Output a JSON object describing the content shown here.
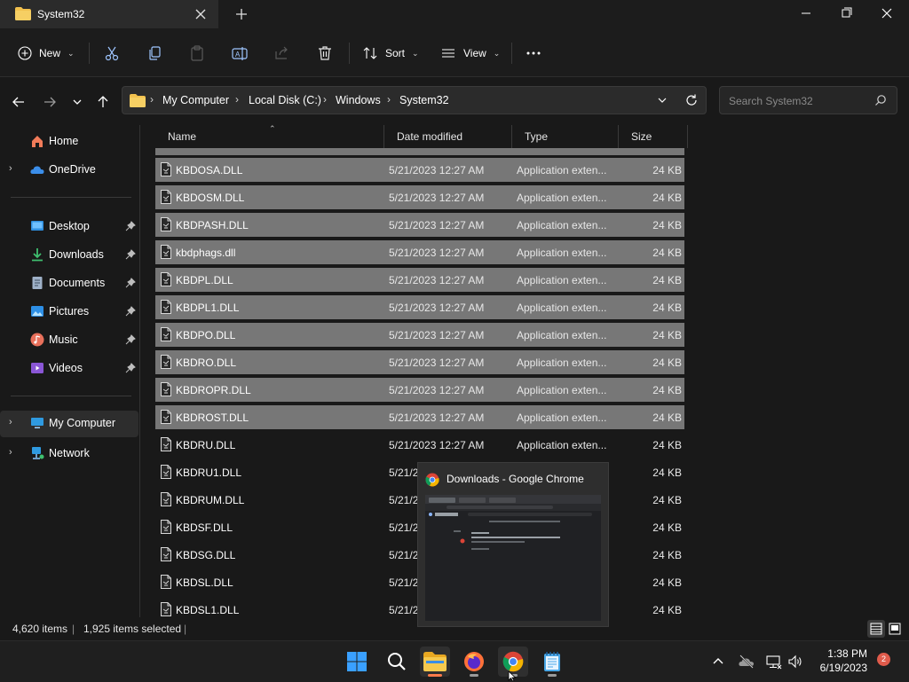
{
  "window": {
    "tab_title": "System32"
  },
  "toolbar": {
    "new_label": "New",
    "sort_label": "Sort",
    "view_label": "View"
  },
  "address": {
    "crumbs": [
      "My Computer",
      "Local Disk (C:)",
      "Windows",
      "System32"
    ]
  },
  "search": {
    "placeholder": "Search System32"
  },
  "sidebar": {
    "items": [
      {
        "label": "Home",
        "icon": "home-icon"
      },
      {
        "label": "OneDrive",
        "icon": "cloud-icon"
      },
      {
        "label": "Desktop",
        "icon": "desktop-icon"
      },
      {
        "label": "Downloads",
        "icon": "download-icon"
      },
      {
        "label": "Documents",
        "icon": "document-icon"
      },
      {
        "label": "Pictures",
        "icon": "picture-icon"
      },
      {
        "label": "Music",
        "icon": "music-icon"
      },
      {
        "label": "Videos",
        "icon": "video-icon"
      },
      {
        "label": "My Computer",
        "icon": "computer-icon"
      },
      {
        "label": "Network",
        "icon": "network-icon"
      }
    ]
  },
  "columns": {
    "name": "Name",
    "date": "Date modified",
    "type": "Type",
    "size": "Size"
  },
  "files": [
    {
      "name": "KBDOSA.DLL",
      "date": "5/21/2023 12:27 AM",
      "type": "Application exten...",
      "size": "24 KB"
    },
    {
      "name": "KBDOSM.DLL",
      "date": "5/21/2023 12:27 AM",
      "type": "Application exten...",
      "size": "24 KB"
    },
    {
      "name": "KBDPASH.DLL",
      "date": "5/21/2023 12:27 AM",
      "type": "Application exten...",
      "size": "24 KB"
    },
    {
      "name": "kbdphags.dll",
      "date": "5/21/2023 12:27 AM",
      "type": "Application exten...",
      "size": "24 KB"
    },
    {
      "name": "KBDPL.DLL",
      "date": "5/21/2023 12:27 AM",
      "type": "Application exten...",
      "size": "24 KB"
    },
    {
      "name": "KBDPL1.DLL",
      "date": "5/21/2023 12:27 AM",
      "type": "Application exten...",
      "size": "24 KB"
    },
    {
      "name": "KBDPO.DLL",
      "date": "5/21/2023 12:27 AM",
      "type": "Application exten...",
      "size": "24 KB"
    },
    {
      "name": "KBDRO.DLL",
      "date": "5/21/2023 12:27 AM",
      "type": "Application exten...",
      "size": "24 KB"
    },
    {
      "name": "KBDROPR.DLL",
      "date": "5/21/2023 12:27 AM",
      "type": "Application exten...",
      "size": "24 KB"
    },
    {
      "name": "KBDROST.DLL",
      "date": "5/21/2023 12:27 AM",
      "type": "Application exten...",
      "size": "24 KB"
    },
    {
      "name": "KBDRU.DLL",
      "date": "5/21/2023 12:27 AM",
      "type": "Application exten...",
      "size": "24 KB"
    },
    {
      "name": "KBDRU1.DLL",
      "date": "5/21/2",
      "type": "",
      "size": "24 KB"
    },
    {
      "name": "KBDRUM.DLL",
      "date": "5/21/2",
      "type": "",
      "size": "24 KB"
    },
    {
      "name": "KBDSF.DLL",
      "date": "5/21/2",
      "type": "",
      "size": "24 KB"
    },
    {
      "name": "KBDSG.DLL",
      "date": "5/21/2",
      "type": "",
      "size": "24 KB"
    },
    {
      "name": "KBDSL.DLL",
      "date": "5/21/2",
      "type": "",
      "size": "24 KB"
    },
    {
      "name": "KBDSL1.DLL",
      "date": "5/21/2",
      "type": "",
      "size": "24 KB"
    }
  ],
  "selected_rows": 10,
  "status": {
    "item_count": "4,620 items",
    "selected_count": "1,925 items selected"
  },
  "preview": {
    "title": "Downloads - Google Chrome"
  },
  "taskbar": {
    "time": "1:38 PM",
    "date": "6/19/2023",
    "notification_count": "2"
  },
  "colors": {
    "accent": "#0078d4",
    "selection": "#777777",
    "folder": "#f2c14e",
    "chrome_red": "#db4437",
    "firefox": "#ff7139"
  }
}
